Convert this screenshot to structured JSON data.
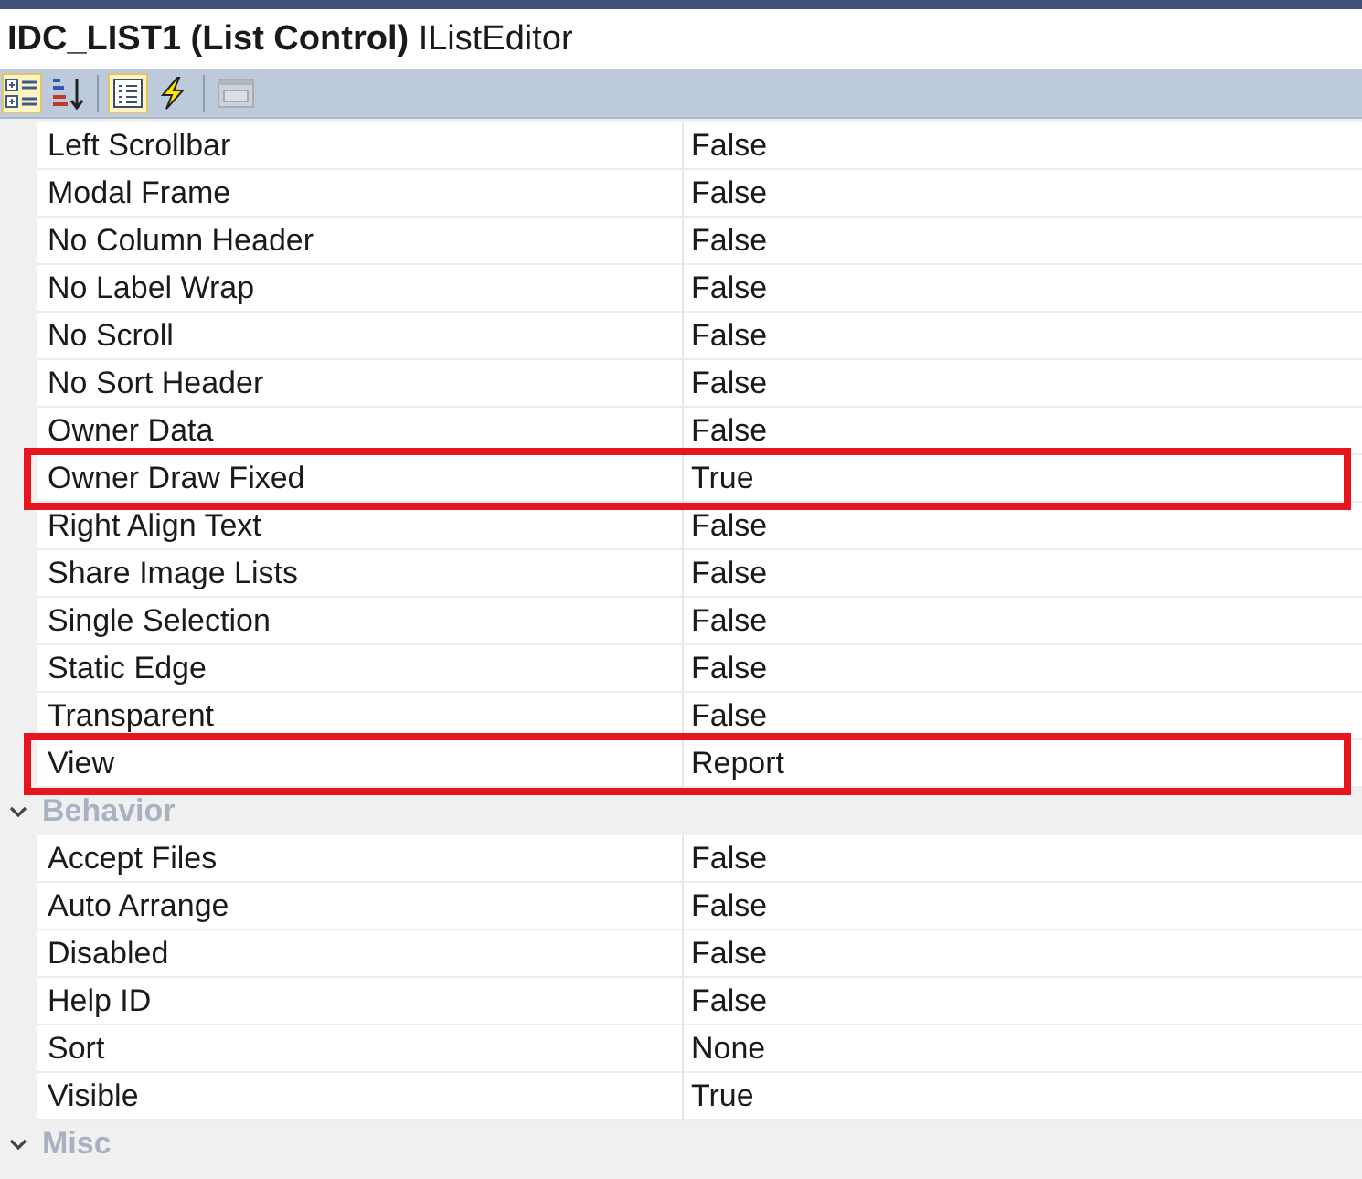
{
  "title": "**IDC_LIST1 (List Control)** IListEditor",
  "toolbar_groups": [
    {
      "buttons": [
        {
          "kind": "categorized",
          "selected": true,
          "disabled": false
        },
        {
          "kind": "alphabetical",
          "selected": false,
          "disabled": false
        }
      ]
    },
    {
      "buttons": [
        {
          "kind": "properties",
          "selected": true,
          "disabled": false
        },
        {
          "kind": "events",
          "selected": false,
          "disabled": false
        }
      ]
    },
    {
      "buttons": [
        {
          "kind": "property-pages",
          "selected": false,
          "disabled": true
        }
      ]
    }
  ],
  "groups": [
    {
      "properties": [
        {
          "name": "Left Scrollbar",
          "value": "False",
          "highlighted": false
        },
        {
          "name": "Modal Frame",
          "value": "False",
          "highlighted": false
        },
        {
          "name": "No Column Header",
          "value": "False",
          "highlighted": false
        },
        {
          "name": "No Label Wrap",
          "value": "False",
          "highlighted": false
        },
        {
          "name": "No Scroll",
          "value": "False",
          "highlighted": false
        },
        {
          "name": "No Sort Header",
          "value": "False",
          "highlighted": false
        },
        {
          "name": "Owner Data",
          "value": "False",
          "highlighted": false
        },
        {
          "name": "Owner Draw Fixed",
          "value": "True",
          "highlighted": true
        },
        {
          "name": "Right Align Text",
          "value": "False",
          "highlighted": false
        },
        {
          "name": "Share Image Lists",
          "value": "False",
          "highlighted": false
        },
        {
          "name": "Single Selection",
          "value": "False",
          "highlighted": false
        },
        {
          "name": "Static Edge",
          "value": "False",
          "highlighted": false
        },
        {
          "name": "Transparent",
          "value": "False",
          "highlighted": false
        },
        {
          "name": "View",
          "value": "Report",
          "highlighted": true
        }
      ]
    },
    {
      "name": "Behavior",
      "expanded": true,
      "properties": [
        {
          "name": "Accept Files",
          "value": "False",
          "highlighted": false
        },
        {
          "name": "Auto Arrange",
          "value": "False",
          "highlighted": false
        },
        {
          "name": "Disabled",
          "value": "False",
          "highlighted": false
        },
        {
          "name": "Help ID",
          "value": "False",
          "highlighted": false
        },
        {
          "name": "Sort",
          "value": "None",
          "highlighted": false
        },
        {
          "name": "Visible",
          "value": "True",
          "highlighted": false
        }
      ]
    },
    {
      "name": "Misc",
      "expanded": true
    }
  ]
}
